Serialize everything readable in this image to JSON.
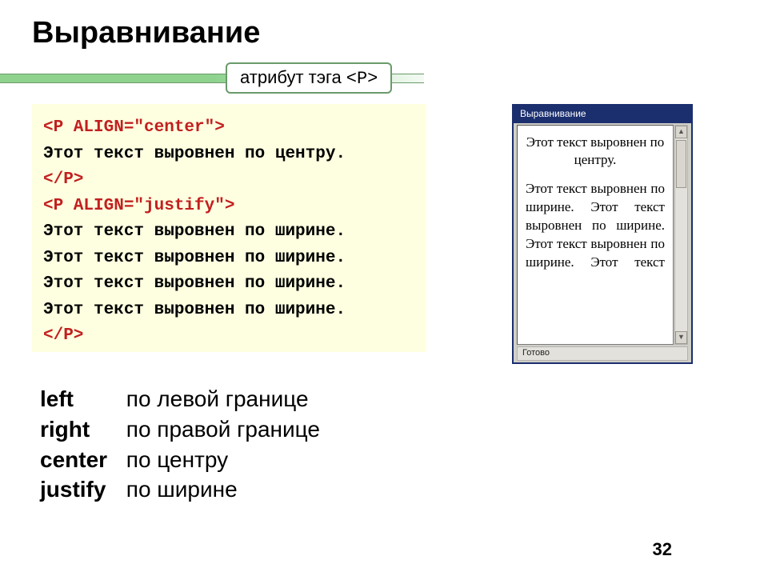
{
  "heading": "Выравнивание",
  "tag_label": {
    "prefix": "атрибут тэга",
    "tag": "<P>"
  },
  "code": {
    "l1": "<P ALIGN=\"center\">",
    "l2": "Этот текст выровнен по центру.",
    "l3": "</P>",
    "l4": "<P ALIGN=\"justify\">",
    "l5": "Этот текст выровнен по ширине.",
    "l6": "Этот текст выровнен по ширине.",
    "l7": "Этот текст выровнен по ширине.",
    "l8": "Этот текст выровнен по ширине.",
    "l9": "</P>"
  },
  "browser": {
    "title": "Выравнивание",
    "status": "Готово",
    "center_text": "Этот текст выровнен по центру.",
    "justify_text": "Этот текст выровнен по ширине. Этот текст выровнен по ширине. Этот текст выровнен по ширине. Этот текст"
  },
  "definitions": [
    {
      "term": "left",
      "desc": "по левой границе"
    },
    {
      "term": "right",
      "desc": "по правой границе"
    },
    {
      "term": "center",
      "desc": "по центру"
    },
    {
      "term": "justify",
      "desc": "по ширине"
    }
  ],
  "page_number": "32"
}
